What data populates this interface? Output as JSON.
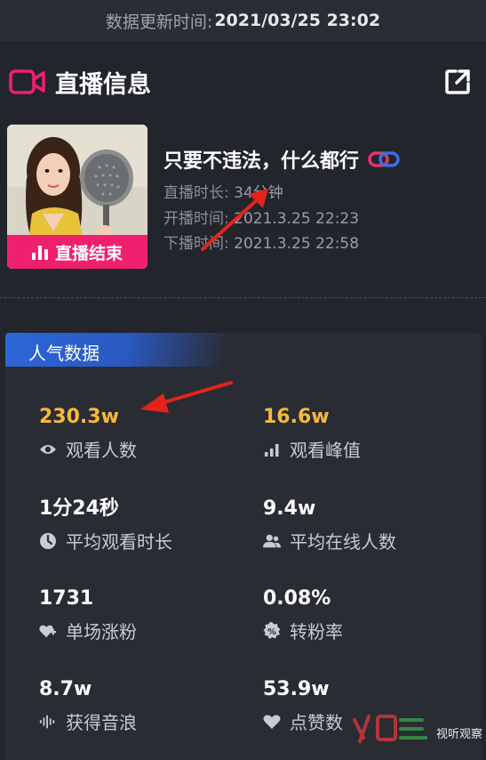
{
  "topbar": {
    "prefix": "数据更新时间:",
    "time": "2021/03/25 23:02"
  },
  "header": {
    "title": "直播信息",
    "camera_icon": "video-camera-icon",
    "share_icon": "external-link-icon",
    "accent": "#f0206f"
  },
  "stream": {
    "title": "只要不违法，什么都行",
    "status_badge": "直播结束",
    "duration_label": "直播时长:",
    "duration_value": "34分钟",
    "start_label": "开播时间:",
    "start_value": "2021.3.25 22:23",
    "end_label": "下播时间:",
    "end_value": "2021.3.25 22:58"
  },
  "popularity": {
    "tab_label": "人气数据",
    "stats": [
      {
        "value": "230.3w",
        "label": "观看人数",
        "icon": "eye-icon",
        "color": "#f6b93b"
      },
      {
        "value": "16.6w",
        "label": "观看峰值",
        "icon": "bar-chart-icon",
        "color": "#f6b93b"
      },
      {
        "value": "1分24秒",
        "label": "平均观看时长",
        "icon": "clock-icon",
        "color": "#ffffff"
      },
      {
        "value": "9.4w",
        "label": "平均在线人数",
        "icon": "users-icon",
        "color": "#ffffff"
      },
      {
        "value": "1731",
        "label": "单场涨粉",
        "icon": "heart-plus-icon",
        "color": "#ffffff"
      },
      {
        "value": "0.08%",
        "label": "转粉率",
        "icon": "percent-badge-icon",
        "color": "#ffffff"
      },
      {
        "value": "8.7w",
        "label": "获得音浪",
        "icon": "sound-wave-icon",
        "color": "#ffffff"
      },
      {
        "value": "53.9w",
        "label": "点赞数",
        "icon": "heart-icon",
        "color": "#ffffff"
      }
    ]
  },
  "watermark": {
    "text": "视听观察"
  }
}
